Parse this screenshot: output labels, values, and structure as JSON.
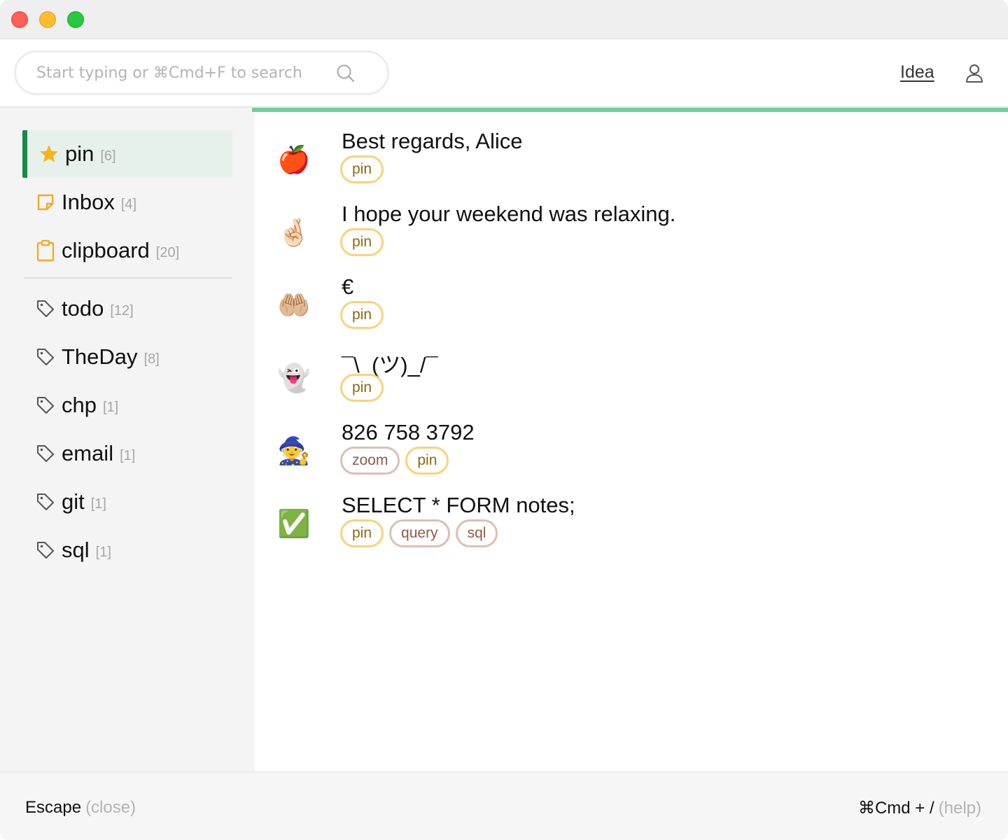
{
  "search": {
    "placeholder": "Start typing or ⌘Cmd+F to search"
  },
  "header": {
    "idea_label": "Idea"
  },
  "sidebar": {
    "items": [
      {
        "label": "pin",
        "count": "[6]",
        "icon": "star-icon"
      },
      {
        "label": "Inbox",
        "count": "[4]",
        "icon": "note-icon"
      },
      {
        "label": "clipboard",
        "count": "[20]",
        "icon": "clipboard-icon"
      },
      {
        "label": "todo",
        "count": "[12]",
        "icon": "tag-icon"
      },
      {
        "label": "TheDay",
        "count": "[8]",
        "icon": "tag-icon"
      },
      {
        "label": "chp",
        "count": "[1]",
        "icon": "tag-icon"
      },
      {
        "label": "email",
        "count": "[1]",
        "icon": "tag-icon"
      },
      {
        "label": "git",
        "count": "[1]",
        "icon": "tag-icon"
      },
      {
        "label": "sql",
        "count": "[1]",
        "icon": "tag-icon"
      }
    ]
  },
  "notes": [
    {
      "emoji": "🍎",
      "text": "Best regards, Alice",
      "tags": [
        "pin"
      ]
    },
    {
      "emoji": "🤞🏻",
      "text": "I hope your weekend was relaxing.",
      "tags": [
        "pin"
      ]
    },
    {
      "emoji": "🤲🏼",
      "text": "€",
      "tags": [
        "pin"
      ]
    },
    {
      "emoji": "👻",
      "text": "¯\\_(ツ)_/¯",
      "tags": [
        "pin"
      ]
    },
    {
      "emoji": "🧙",
      "text": "826 758 3792",
      "tags": [
        "zoom",
        "pin"
      ]
    },
    {
      "emoji": "✅",
      "text": "SELECT * FORM notes;",
      "tags": [
        "pin",
        "query",
        "sql"
      ]
    }
  ],
  "footer": {
    "left_key": "Escape",
    "left_hint": "(close)",
    "right_key": "⌘Cmd + /",
    "right_hint": "(help)"
  },
  "colors": {
    "accent": "#198a4a",
    "progress": "#6ccf9f",
    "pin_tag_border": "#f7d37b",
    "other_tag_border": "#dbc0b2",
    "star": "#f5b41f"
  }
}
